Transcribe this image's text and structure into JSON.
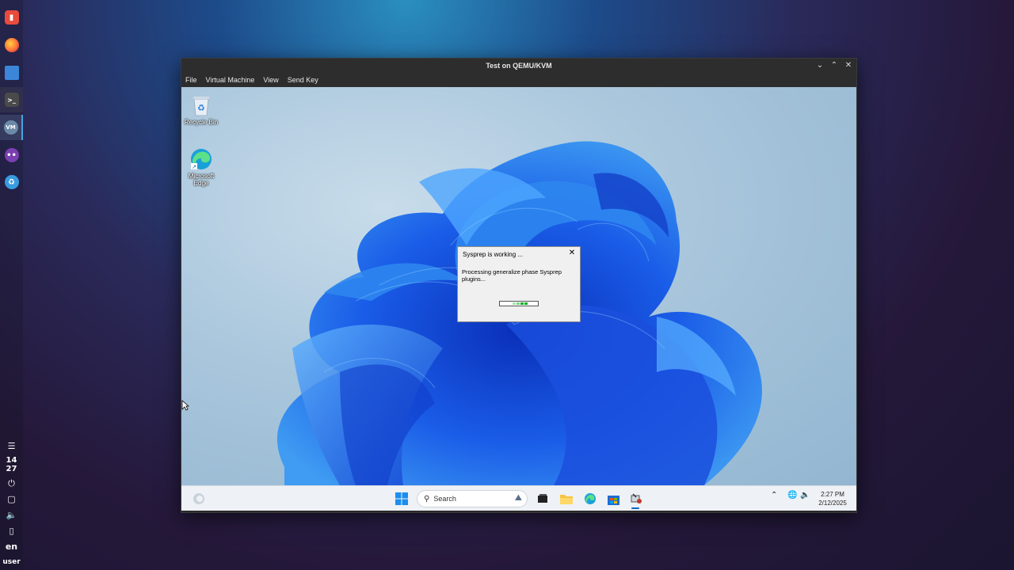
{
  "host": {
    "dock": {
      "apps": [
        {
          "name": "app-launcher-icon",
          "color": "#e84b3c"
        },
        {
          "name": "firefox-icon",
          "color": "#ff7139"
        },
        {
          "name": "files-icon",
          "color": "#3b86d8"
        },
        {
          "name": "terminal-icon",
          "color": "#3a3a3a"
        },
        {
          "name": "virt-manager-icon",
          "color": "#5a7b99"
        },
        {
          "name": "owl-icon",
          "color": "#7a3fb0"
        },
        {
          "name": "recycle-icon",
          "color": "#3a9be0"
        }
      ],
      "clock_hour": "14",
      "clock_min": "27",
      "lang": "en",
      "user": "user"
    }
  },
  "vm": {
    "title": "Test on QEMU/KVM",
    "menu": {
      "file": "File",
      "virtual_machine": "Virtual Machine",
      "view": "View",
      "send_key": "Send Key"
    },
    "desktop": {
      "recycle_bin": "Recycle Bin",
      "edge_line1": "Microsoft",
      "edge_line2": "Edge"
    },
    "dialog": {
      "title": "Sysprep is working ...",
      "message": "Processing generalize phase Sysprep plugins...",
      "progress_animated": true
    },
    "taskbar": {
      "search_placeholder": "Search",
      "time": "2:27 PM",
      "date": "2/12/2025"
    }
  },
  "colors": {
    "accent": "#0067c0",
    "progress": "#06b025",
    "bloom_dark": "#0b3fd6",
    "bloom_light": "#3f9cf2"
  }
}
